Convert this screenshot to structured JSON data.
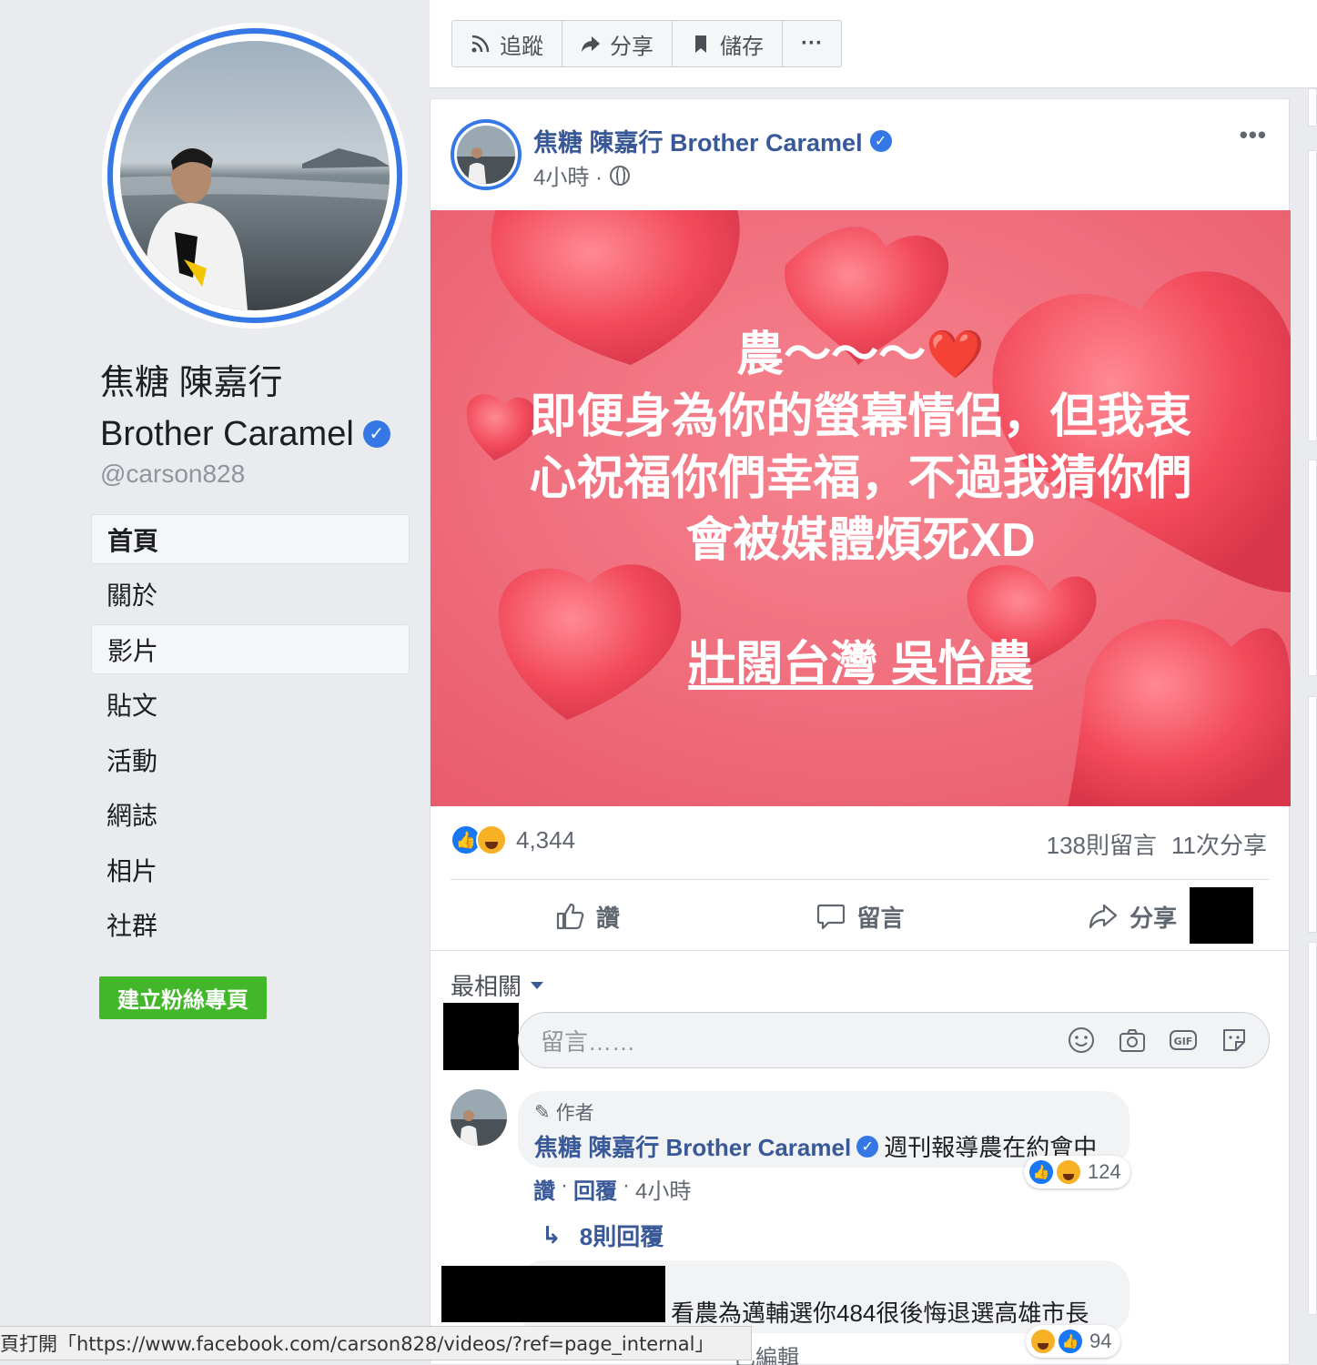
{
  "page": {
    "name_line1": "焦糖 陳嘉行",
    "name_line2": "Brother Caramel",
    "handle": "@carson828",
    "verified_icon": "verified-badge-icon"
  },
  "nav": [
    {
      "label": "首頁",
      "state": "active"
    },
    {
      "label": "關於",
      "state": ""
    },
    {
      "label": "影片",
      "state": "hover"
    },
    {
      "label": "貼文",
      "state": ""
    },
    {
      "label": "活動",
      "state": ""
    },
    {
      "label": "網誌",
      "state": ""
    },
    {
      "label": "相片",
      "state": ""
    },
    {
      "label": "社群",
      "state": ""
    }
  ],
  "create_page_label": "建立粉絲專頁",
  "topbar": {
    "follow": "追蹤",
    "share": "分享",
    "save": "儲存",
    "more": "···"
  },
  "post": {
    "author": "焦糖 陳嘉行 Brother Caramel",
    "time": "4小時 ·",
    "more": "•••",
    "image_text": {
      "line1": "農～～～❤️",
      "line2": "即便身為你的螢幕情侶，但我衷",
      "line3": "心祝福你們幸福，不過我猜你們",
      "line4": "會被媒體煩死XD",
      "tag": "壯闊台灣 吳怡農"
    },
    "reaction_count": "4,344",
    "comments_count": "138則留言",
    "shares_count": "11次分享",
    "like_label": "讚",
    "comment_label": "留言",
    "share_label": "分享"
  },
  "comments": {
    "sort_label": "最相關",
    "input_placeholder": "留言……",
    "input_icons": [
      "emoji-icon",
      "camera-icon",
      "gif-icon",
      "sticker-icon"
    ],
    "c1": {
      "author_tag": "作者",
      "author": "焦糖 陳嘉行 Brother Caramel",
      "text": "週刊報導農在約會中",
      "reactions": "124",
      "like": "讚",
      "reply": "回覆",
      "time": "4小時",
      "replies_label": "8則回覆"
    },
    "c2": {
      "text": "看農為邁輔選你484很後悔退選高雄市長",
      "reactions": "94",
      "meta_edit": "已編輯"
    }
  },
  "statusbar": "頁打開「https://www.facebook.com/carson828/videos/?ref=page_internal」",
  "colors": {
    "link_blue": "#385898",
    "verified_blue": "#3578e5",
    "create_green": "#42b72a",
    "image_bg": "#ef6a78"
  }
}
